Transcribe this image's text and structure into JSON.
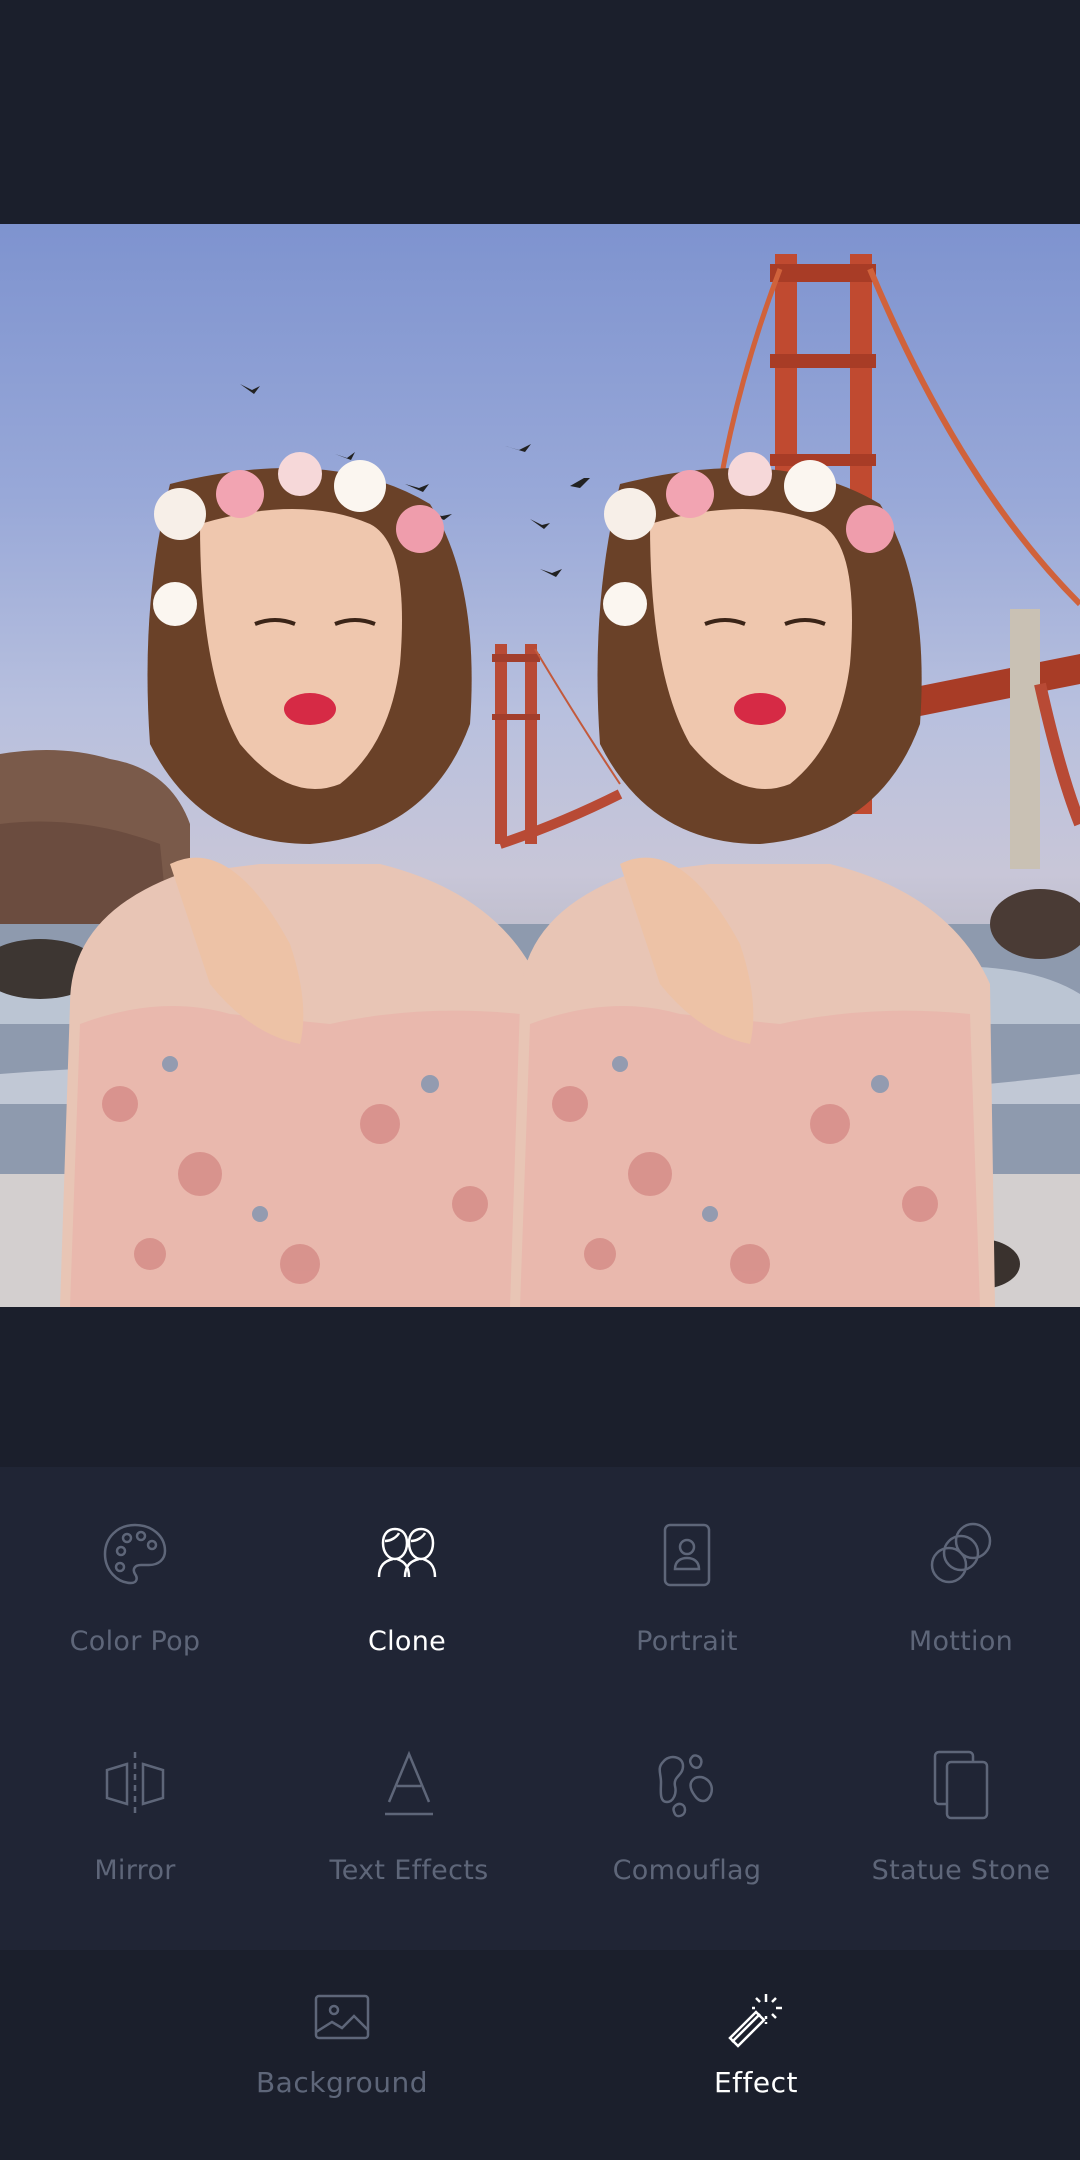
{
  "photo": {
    "subject": "clone-effect-photo"
  },
  "effects": {
    "items": [
      {
        "label": "Color Pop",
        "icon": "palette-icon"
      },
      {
        "label": "Clone",
        "icon": "clone-people-icon"
      },
      {
        "label": "Portrait",
        "icon": "portrait-icon"
      },
      {
        "label": "Mottion",
        "icon": "motion-circles-icon"
      },
      {
        "label": "Mirror",
        "icon": "mirror-icon"
      },
      {
        "label": "Text Effects",
        "icon": "text-effects-icon"
      },
      {
        "label": "Comouflag",
        "icon": "camouflage-icon"
      },
      {
        "label": "Statue Stone",
        "icon": "statue-stone-icon"
      }
    ],
    "selected": "Clone"
  },
  "tabbar": {
    "tabs": [
      {
        "label": "Background",
        "icon": "image-icon"
      },
      {
        "label": "Effect",
        "icon": "magic-wand-icon"
      }
    ],
    "selected": "Effect"
  },
  "colors": {
    "background": "#1b1f2c",
    "panel": "#202535",
    "inactive": "#5e6679",
    "active": "#ffffff"
  }
}
